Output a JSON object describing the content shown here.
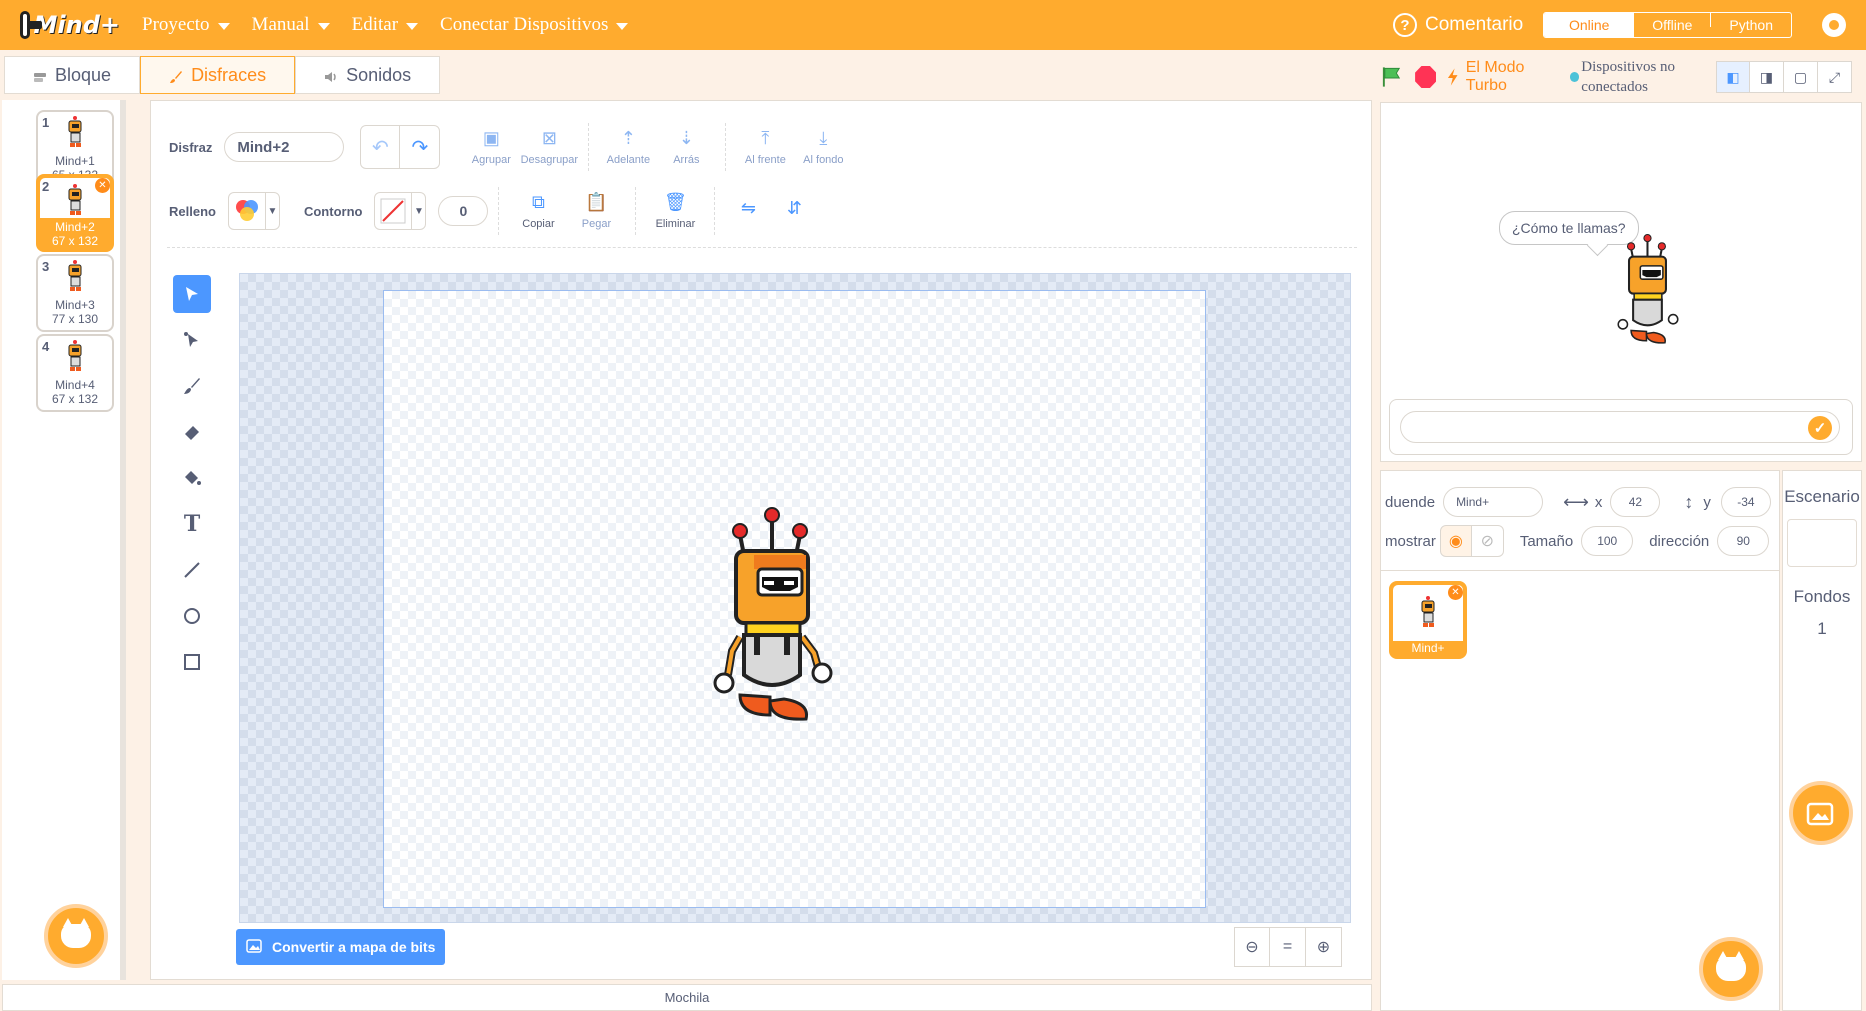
{
  "menubar": {
    "logo_text": "Mind+",
    "items": [
      "Proyecto",
      "Manual",
      "Editar",
      "Conectar Dispositivos"
    ],
    "comment_label": "Comentario",
    "modes": [
      "Online",
      "Offline",
      "Python"
    ],
    "active_mode": "Online"
  },
  "tabs": [
    "Bloque",
    "Disfraces",
    "Sonidos"
  ],
  "active_tab": "Disfraces",
  "costumes": [
    {
      "num": "1",
      "name": "Mind+1",
      "size": "65 x 132"
    },
    {
      "num": "2",
      "name": "Mind+2",
      "size": "67 x 132"
    },
    {
      "num": "3",
      "name": "Mind+3",
      "size": "77 x 130"
    },
    {
      "num": "4",
      "name": "Mind+4",
      "size": "67 x 132"
    }
  ],
  "editor": {
    "costume_label": "Disfraz",
    "costume_name": "Mind+2",
    "group_label": "Agrupar",
    "ungroup_label": "Desagrupar",
    "forward_label": "Adelante",
    "backward_label": "Arrás",
    "front_label": "Al frente",
    "back_label": "Al fondo",
    "fill_label": "Relleno",
    "outline_label": "Contorno",
    "outline_width": "0",
    "copy_label": "Copiar",
    "paste_label": "Pegar",
    "delete_label": "Eliminar",
    "bitmap_button": "Convertir a mapa de bits",
    "zoom_reset": "="
  },
  "backpack_label": "Mochila",
  "stage_header": {
    "turbo_label": "El Modo Turbo",
    "device_status": "Dispositivos no conectados"
  },
  "stage": {
    "speech_bubble": "¿Cómo te llamas?"
  },
  "sprite_info": {
    "sprite_label": "duende",
    "sprite_name": "Mind+",
    "x_label": "x",
    "x_value": "42",
    "y_label": "y",
    "y_value": "-34",
    "show_label": "mostrar",
    "size_label": "Tamaño",
    "size_value": "100",
    "direction_label": "dirección",
    "direction_value": "90",
    "sprite_tile_name": "Mind+"
  },
  "stage_pane": {
    "title": "Escenario",
    "backdrops_label": "Fondos",
    "backdrops_count": "1"
  },
  "colors": {
    "brand": "#ffab2e",
    "accent": "#4c97ff",
    "stop": "#ff3355",
    "turbo": "#ff8c1a"
  }
}
